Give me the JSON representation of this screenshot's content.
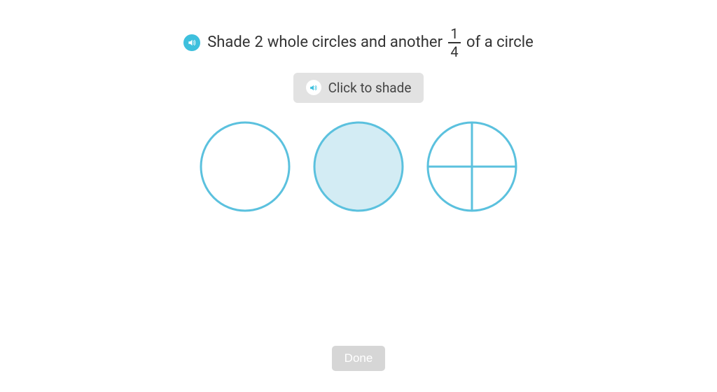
{
  "instruction": {
    "prefix": "Shade",
    "whole_count": "2",
    "mid1": "whole circles and another",
    "fraction_numerator": "1",
    "fraction_denominator": "4",
    "suffix": "of a circle"
  },
  "hint": {
    "label": "Click to shade"
  },
  "circles": [
    {
      "shaded": false,
      "divided": false
    },
    {
      "shaded": true,
      "divided": false
    },
    {
      "shaded": false,
      "divided": true
    }
  ],
  "colors": {
    "stroke": "#5bc1de",
    "fill_shaded": "#d3ecf4",
    "fill_empty": "#ffffff"
  },
  "done_button": {
    "label": "Done"
  }
}
